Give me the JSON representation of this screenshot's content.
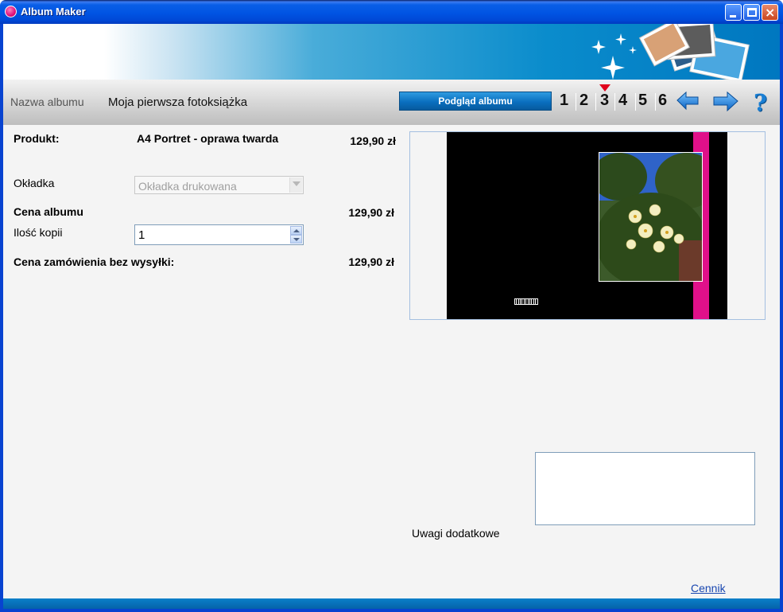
{
  "window": {
    "title": "Album Maker",
    "controls": {
      "minimize": "minimize",
      "maximize": "maximize",
      "close": "×"
    }
  },
  "toolbar": {
    "album_name_label": "Nazwa albumu",
    "album_name_value": "Moja pierwsza fotoksiążka",
    "preview_button": "Podgląd albumu",
    "pages": [
      "1",
      "2",
      "3",
      "4",
      "5",
      "6"
    ],
    "active_page": "3",
    "help": "?"
  },
  "form": {
    "product_label": "Produkt:",
    "product_value": "A4 Portret - oprawa twarda",
    "product_price": "129,90 zł",
    "cover_label": "Okładka",
    "cover_select_value": "Okładka drukowana",
    "album_price_label": "Cena albumu",
    "album_price": "129,90 zł",
    "copies_label": "Ilość kopii",
    "copies_value": "1",
    "order_price_label": "Cena zamówienia bez wysyłki:",
    "order_price": "129,90 zł"
  },
  "notes": {
    "label": "Uwagi dodatkowe",
    "value": ""
  },
  "links": {
    "price_list": "Cennik"
  },
  "colors": {
    "accent_pink": "#e0108a",
    "active_marker": "#e0001b",
    "preview_button": "#0a6fbf"
  }
}
